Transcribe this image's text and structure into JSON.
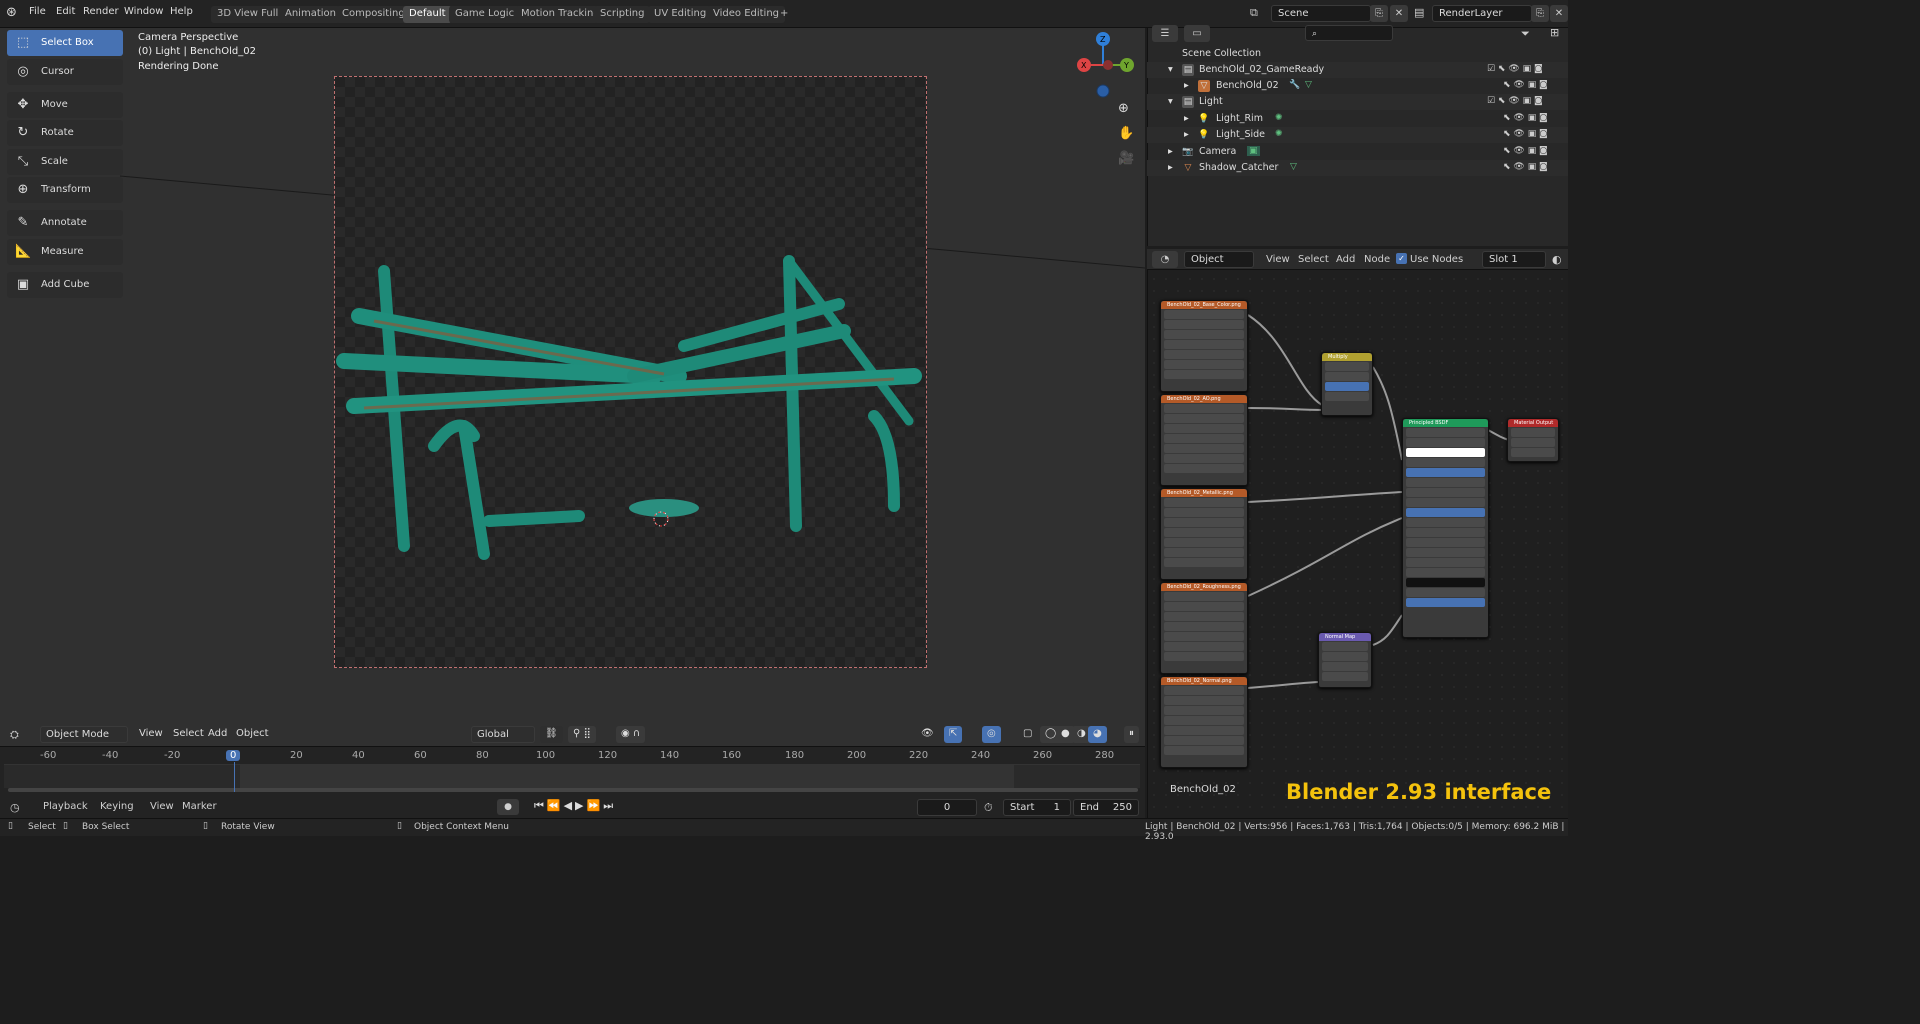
{
  "menu": [
    "File",
    "Edit",
    "Render",
    "Window",
    "Help"
  ],
  "workspaces": [
    "3D View Full",
    "Animation",
    "Compositing",
    "Default",
    "Game Logic",
    "Motion Tracking",
    "Scripting",
    "UV Editing",
    "Video Editing"
  ],
  "active_workspace": "Default",
  "add_tab": "+",
  "scene": {
    "label": "Scene"
  },
  "view_layer": {
    "label": "RenderLayer"
  },
  "tools": [
    {
      "label": "Select Box",
      "icon": "select-box-icon",
      "glyph": "⬚"
    },
    {
      "label": "Cursor",
      "icon": "cursor-icon",
      "glyph": "◎"
    },
    {
      "label": "Move",
      "icon": "move-icon",
      "glyph": "✥"
    },
    {
      "label": "Rotate",
      "icon": "rotate-icon",
      "glyph": "↻"
    },
    {
      "label": "Scale",
      "icon": "scale-icon",
      "glyph": "⤡"
    },
    {
      "label": "Transform",
      "icon": "transform-icon",
      "glyph": "⊕"
    },
    {
      "label": "Annotate",
      "icon": "annotate-icon",
      "glyph": "✎"
    },
    {
      "label": "Measure",
      "icon": "measure-icon",
      "glyph": "📐"
    },
    {
      "label": "Add Cube",
      "icon": "add-cube-icon",
      "glyph": "▣"
    }
  ],
  "viewport_info": {
    "line1": "Camera Perspective",
    "line2": "(0) Light | BenchOld_02",
    "line3": "Rendering Done"
  },
  "viewport_header": {
    "mode": "Object Mode",
    "menus": [
      "View",
      "Select",
      "Add",
      "Object"
    ],
    "orientation": "Global"
  },
  "gizmo": {
    "x": "X",
    "y": "Y",
    "z": "Z"
  },
  "outliner": {
    "search_placeholder": "",
    "rows": [
      {
        "label": "Scene Collection",
        "icon": "scene-collection-icon",
        "indent": 0
      },
      {
        "label": "BenchOld_02_GameReady",
        "icon": "collection-icon",
        "indent": 1
      },
      {
        "label": "BenchOld_02",
        "icon": "mesh-icon",
        "indent": 2
      },
      {
        "label": "Light",
        "icon": "collection-icon",
        "indent": 1
      },
      {
        "label": "Light_Rim",
        "icon": "light-icon",
        "indent": 2
      },
      {
        "label": "Light_Side",
        "icon": "light-icon",
        "indent": 2
      },
      {
        "label": "Camera",
        "icon": "camera-icon",
        "indent": 1
      },
      {
        "label": "Shadow_Catcher",
        "icon": "mesh-icon",
        "indent": 1
      }
    ]
  },
  "node_editor": {
    "object_label": "Object",
    "menus": [
      "View",
      "Select",
      "Add",
      "Node"
    ],
    "use_nodes": "Use Nodes",
    "slot": "Slot 1",
    "material_name": "BenchOld_02"
  },
  "nodes": {
    "tex1": "BenchOld_02_Base_Color.png",
    "tex2": "BenchOld_02_AO.png",
    "tex3": "BenchOld_02_Metallic.png",
    "tex4": "BenchOld_02_Roughness.png",
    "tex5": "BenchOld_02_Normal.png",
    "multiply": "Multiply",
    "bsdf": "Principled BSDF",
    "output": "Material Output",
    "normal": "Normal Map"
  },
  "timeline": {
    "ticks": [
      "-60",
      "-40",
      "-20",
      "0",
      "20",
      "40",
      "60",
      "80",
      "100",
      "120",
      "140",
      "160",
      "180",
      "200",
      "220",
      "240",
      "260",
      "280"
    ],
    "current_frame": "0",
    "menus": [
      "Playback",
      "Keying",
      "View",
      "Marker"
    ],
    "frame_value": "0",
    "start_label": "Start",
    "start": "1",
    "end_label": "End",
    "end": "250"
  },
  "status": {
    "left": [
      "Select",
      "Box Select",
      "Rotate View",
      "Object Context Menu"
    ],
    "right": "Light | BenchOld_02 | Verts:956 | Faces:1,763 | Tris:1,764 | Objects:0/5 | Memory: 696.2 MiB | 2.93.0"
  },
  "watermark": "Blender 2.93 interface"
}
